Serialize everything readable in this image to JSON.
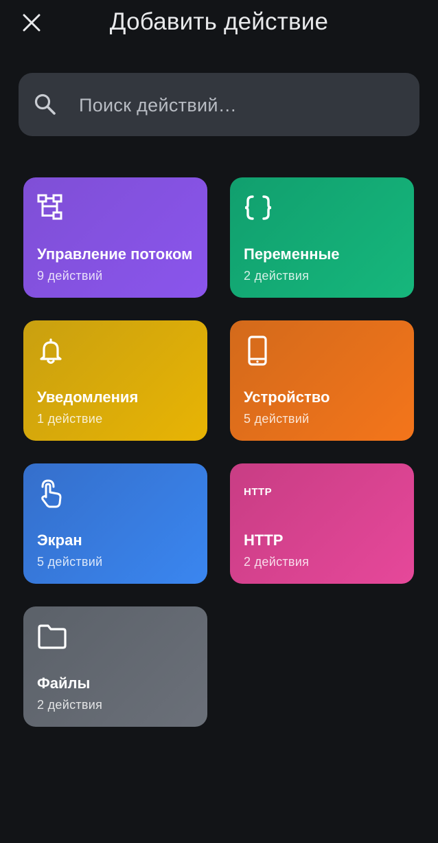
{
  "header": {
    "title": "Добавить действие"
  },
  "search": {
    "placeholder": "Поиск действий…"
  },
  "categories": [
    {
      "id": "flow",
      "name": "Управление потоком",
      "count": "9 действий",
      "icon": "flow-chart-icon"
    },
    {
      "id": "variables",
      "name": "Переменные",
      "count": "2 действия",
      "icon": "braces-icon"
    },
    {
      "id": "notifications",
      "name": "Уведомления",
      "count": "1 действие",
      "icon": "bell-icon"
    },
    {
      "id": "device",
      "name": "Устройство",
      "count": "5 действий",
      "icon": "phone-icon"
    },
    {
      "id": "screen",
      "name": "Экран",
      "count": "5 действий",
      "icon": "touch-icon"
    },
    {
      "id": "http",
      "name": "HTTP",
      "count": "2 действия",
      "icon": "http-icon",
      "icon_text": "HTTP"
    },
    {
      "id": "files",
      "name": "Файлы",
      "count": "2 действия",
      "icon": "folder-icon"
    }
  ],
  "colors": {
    "background": "#121417",
    "search_bg": "#33373e",
    "flow": "#8a55ec",
    "variables": "#16b77c",
    "notifications": "#e8b404",
    "device": "#f4751b",
    "screen": "#3a86f0",
    "http": "#e6489a",
    "files": "#6b7079"
  }
}
